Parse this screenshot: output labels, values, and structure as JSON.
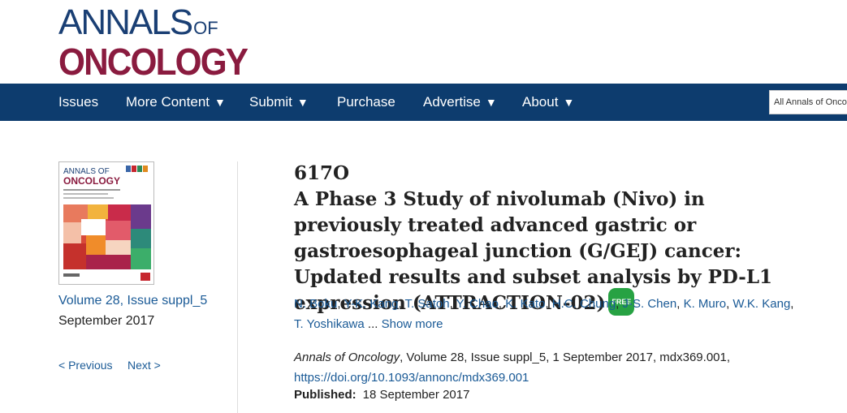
{
  "logo": {
    "line1": "ANNALS",
    "of": "OF",
    "line2": "ONCOLOGY"
  },
  "nav": {
    "items": [
      {
        "label": "Issues",
        "dropdown": false
      },
      {
        "label": "More Content",
        "dropdown": true
      },
      {
        "label": "Submit",
        "dropdown": true
      },
      {
        "label": "Purchase",
        "dropdown": false
      },
      {
        "label": "Advertise",
        "dropdown": true
      },
      {
        "label": "About",
        "dropdown": true
      }
    ],
    "caret": "▼",
    "search_scope": "All Annals of Onco"
  },
  "sidebar": {
    "cover_alt": "Annals of Oncology cover",
    "cover_title_line1": "ANNALS OF",
    "cover_title_line2": "ONCOLOGY",
    "volume_link": "Volume 28, Issue suppl_5",
    "date": "September 2017",
    "prev": "< Previous",
    "next": "Next >"
  },
  "article": {
    "number": "617O",
    "title": "A Phase 3 Study of nivolumab (Nivo) in previously treated advanced gastric or gastroesophageal junction (G/GEJ) cancer: Updated results and subset analysis by PD-L1 expression (ATTRACTION-02)",
    "free_badge": "FREE",
    "authors": [
      "N. Boku",
      "Y-K. Kang",
      "T. Satoh",
      "Y. Chao",
      "K. Kato",
      "H.C. Chung",
      "J-S. Chen",
      "K. Muro",
      "W.K. Kang",
      "T. Yoshikawa"
    ],
    "ellipsis": "...",
    "show_more": "Show more",
    "journal": "Annals of Oncology",
    "citation_rest": ", Volume 28, Issue suppl_5, 1 September 2017, mdx369.001,",
    "doi": "https://doi.org/10.1093/annonc/mdx369.001",
    "published_label": "Published:",
    "published_date": "18 September 2017"
  },
  "colors": {
    "nav_bg": "#0d3c6e",
    "link": "#1a5a96",
    "logo_blue": "#1a3f74",
    "logo_red": "#8a1b3f",
    "free_green": "#27a243"
  }
}
